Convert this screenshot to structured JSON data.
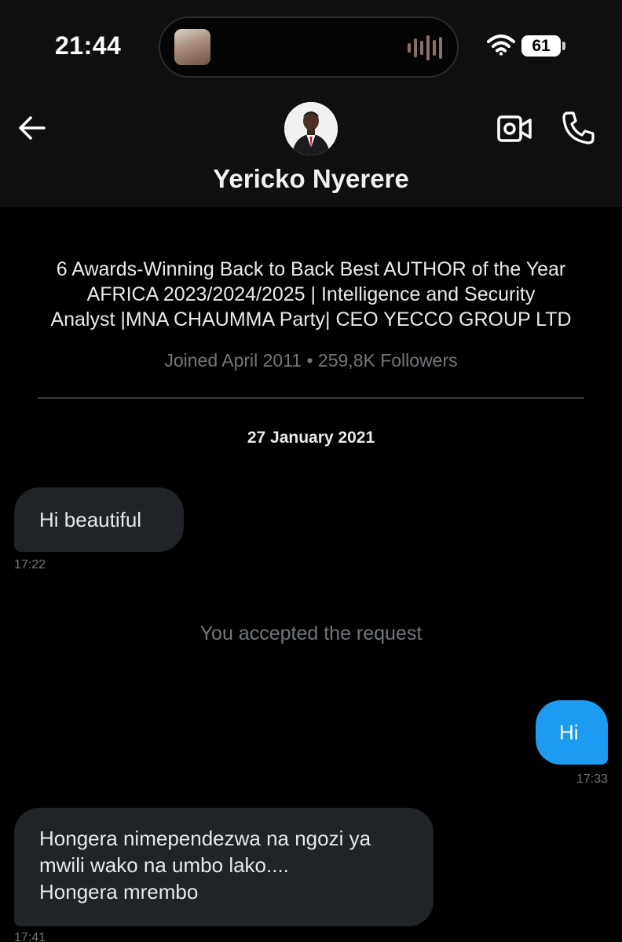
{
  "status_bar": {
    "time": "21:44",
    "battery": "61",
    "wifi_icon": "wifi-icon",
    "island_icon": "audio-waveform-icon"
  },
  "header": {
    "name": "Yericko Nyerere",
    "back_icon": "back-arrow-icon",
    "video_icon": "video-call-icon",
    "phone_icon": "phone-icon"
  },
  "profile": {
    "bio_line1": "6 Awards-Winning Back to Back Best AUTHOR of the Year",
    "bio_line2": "AFRICA 2023/2024/2025 | Intelligence and Security",
    "bio_line3": "Analyst |MNA CHAUMMA Party| CEO YECCO GROUP LTD",
    "meta": "Joined April 2011 • 259,8K Followers"
  },
  "conversation": {
    "date": "27 January 2021",
    "messages": [
      {
        "direction": "in",
        "lines": [
          "Hi beautiful"
        ],
        "time": "17:22"
      },
      {
        "direction": "system",
        "text": "You accepted the request"
      },
      {
        "direction": "out",
        "lines": [
          "Hi"
        ],
        "time": "17:33"
      },
      {
        "direction": "in",
        "lines": [
          "Hongera nimependezwa na ngozi ya",
          "mwili wako na umbo lako....",
          "Hongera mrembo"
        ],
        "time": "17:41"
      }
    ]
  },
  "colors": {
    "background": "#000000",
    "header_background": "#0f0f0f",
    "incoming_bubble": "#202327",
    "outgoing_bubble": "#1d9bf0",
    "secondary_text": "#71767b"
  }
}
